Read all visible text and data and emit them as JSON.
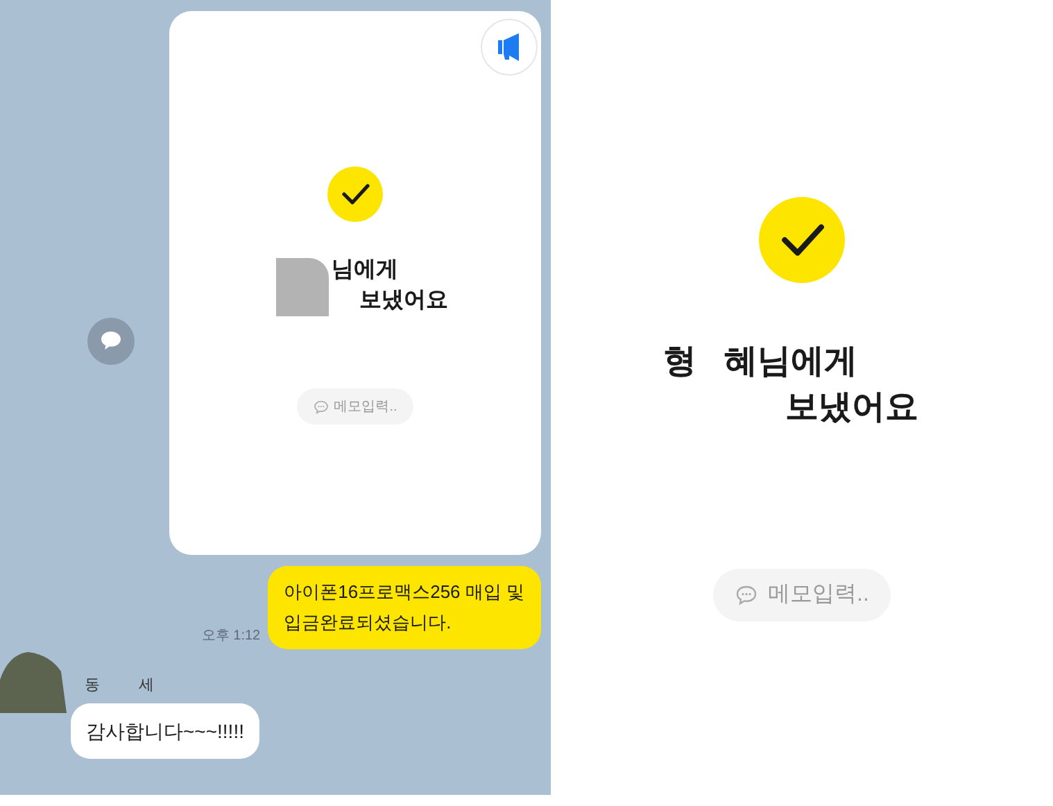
{
  "chat": {
    "card": {
      "title_lines": [
        "님에게",
        "보냈어요"
      ],
      "memo_placeholder": "메모입력.."
    },
    "messages": [
      {
        "kind": "sent",
        "lines": [
          "아이폰16프로맥스256 매입 및",
          "입금완료되셨습니다."
        ],
        "time": "오후 1:12"
      },
      {
        "kind": "received",
        "sender_parts": [
          "동",
          "세"
        ],
        "lines": [
          "감사합니다~~~!!!!!"
        ]
      }
    ]
  },
  "detail": {
    "name_parts": [
      "형",
      "혜님에게"
    ],
    "line2": "보냈어요",
    "memo_placeholder": "메모입력.."
  }
}
